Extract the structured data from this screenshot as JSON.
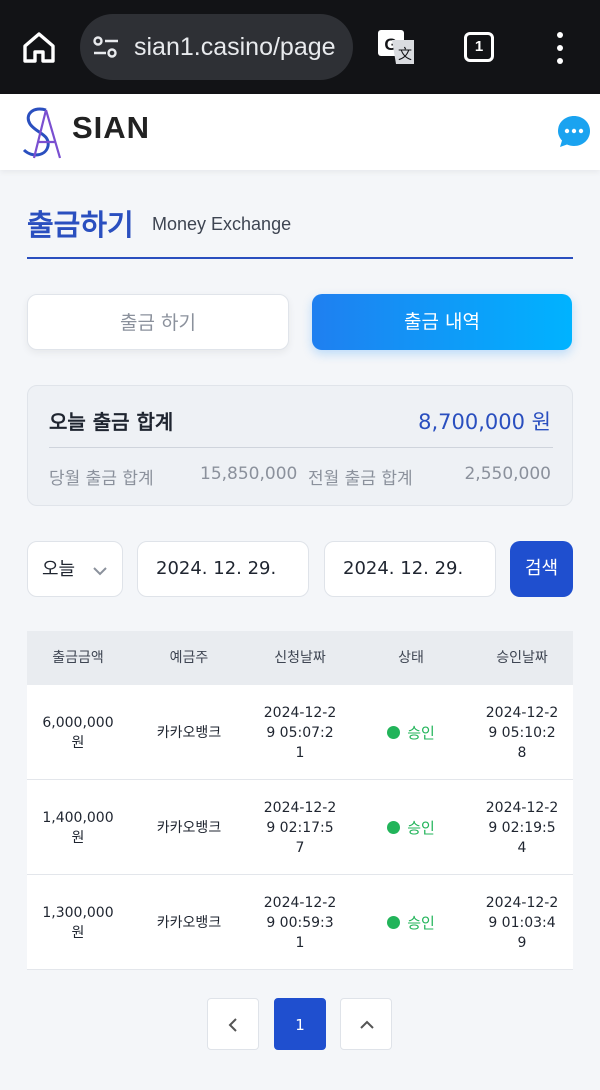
{
  "browser": {
    "url": "sian1.casino/page",
    "tab_count": "1",
    "icons": [
      "home-icon",
      "tune-icon",
      "translate-icon",
      "tabs-icon",
      "more-vert-icon"
    ]
  },
  "header": {
    "logo_text": "SIAN",
    "icons": [
      "sian-logo-icon",
      "chat-icon"
    ],
    "accent_color": "#2a4fbf"
  },
  "page": {
    "title": "출금하기",
    "subtitle": "Money Exchange"
  },
  "tabs": [
    {
      "label": "출금 하기",
      "active": false
    },
    {
      "label": "출금 내역",
      "active": true
    }
  ],
  "summary": {
    "today_label": "오늘 출금 합계",
    "today_value": "8,700,000 원",
    "month_label": "당월 출금 합계",
    "month_value": "15,850,000",
    "prev_month_label": "전월 출금 합계",
    "prev_month_value": "2,550,000"
  },
  "filter": {
    "period": "오늘",
    "date_from": "2024. 12. 29.",
    "date_to": "2024. 12. 29.",
    "search_label": "검색"
  },
  "table": {
    "columns": [
      "출금금액",
      "예금주",
      "신청날짜",
      "상태",
      "승인날짜"
    ],
    "rows": [
      {
        "amount": "6,000,000 원",
        "holder": "카카오뱅크",
        "requested": "2024-12-29 05:07:21",
        "status": "승인",
        "approved": "2024-12-29 05:10:28"
      },
      {
        "amount": "1,400,000 원",
        "holder": "카카오뱅크",
        "requested": "2024-12-29 02:17:57",
        "status": "승인",
        "approved": "2024-12-29 02:19:54"
      },
      {
        "amount": "1,300,000 원",
        "holder": "카카오뱅크",
        "requested": "2024-12-29 00:59:31",
        "status": "승인",
        "approved": "2024-12-29 01:03:49"
      }
    ],
    "status_color": "#22b45a"
  },
  "pagination": {
    "current_page": "1"
  }
}
